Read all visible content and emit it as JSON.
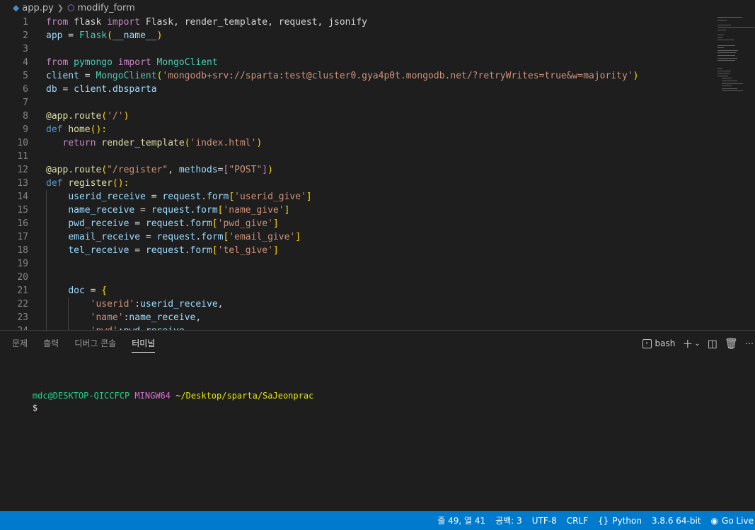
{
  "breadcrumb": {
    "file_icon": "python-file-icon",
    "file": "app.py",
    "separator_icon": "chevron-right-icon",
    "symbol_icon": "symbol-method-icon",
    "symbol": "modify_form"
  },
  "editor": {
    "lines": [
      {
        "n": "1",
        "indent": 0,
        "tokens": [
          {
            "t": "from",
            "c": "ctrl"
          },
          {
            "t": " flask ",
            "c": "op"
          },
          {
            "t": "import",
            "c": "ctrl"
          },
          {
            "t": " Flask, render_template, request, jsonify",
            "c": "op"
          }
        ]
      },
      {
        "n": "2",
        "indent": 0,
        "tokens": [
          {
            "t": "app",
            "c": "var"
          },
          {
            "t": " = ",
            "c": "op"
          },
          {
            "t": "Flask",
            "c": "cls"
          },
          {
            "t": "(",
            "c": "br1"
          },
          {
            "t": "__name__",
            "c": "var"
          },
          {
            "t": ")",
            "c": "br1"
          }
        ]
      },
      {
        "n": "3",
        "indent": 0,
        "tokens": []
      },
      {
        "n": "4",
        "indent": 0,
        "tokens": [
          {
            "t": "from",
            "c": "ctrl"
          },
          {
            "t": " pymongo ",
            "c": "cls"
          },
          {
            "t": "import",
            "c": "ctrl"
          },
          {
            "t": " MongoClient",
            "c": "cls"
          }
        ]
      },
      {
        "n": "5",
        "indent": 0,
        "tokens": [
          {
            "t": "client",
            "c": "var"
          },
          {
            "t": " = ",
            "c": "op"
          },
          {
            "t": "MongoClient",
            "c": "cls"
          },
          {
            "t": "(",
            "c": "br1"
          },
          {
            "t": "'mongodb+srv://sparta:test@cluster0.gya4p0t.mongodb.net/?retryWrites=true&w=majority'",
            "c": "str"
          },
          {
            "t": ")",
            "c": "br1"
          }
        ]
      },
      {
        "n": "6",
        "indent": 0,
        "tokens": [
          {
            "t": "db",
            "c": "var"
          },
          {
            "t": " = ",
            "c": "op"
          },
          {
            "t": "client",
            "c": "var"
          },
          {
            "t": ".",
            "c": "op"
          },
          {
            "t": "dbsparta",
            "c": "var"
          }
        ]
      },
      {
        "n": "7",
        "indent": 0,
        "tokens": []
      },
      {
        "n": "8",
        "indent": 0,
        "tokens": [
          {
            "t": "@app.route",
            "c": "fn"
          },
          {
            "t": "(",
            "c": "br1"
          },
          {
            "t": "'/'",
            "c": "str"
          },
          {
            "t": ")",
            "c": "br1"
          }
        ]
      },
      {
        "n": "9",
        "indent": 0,
        "tokens": [
          {
            "t": "def",
            "c": "kw"
          },
          {
            "t": " ",
            "c": "op"
          },
          {
            "t": "home",
            "c": "fn"
          },
          {
            "t": "():",
            "c": "br1"
          }
        ]
      },
      {
        "n": "10",
        "indent": 0,
        "tokens": [
          {
            "t": "   ",
            "c": "op"
          },
          {
            "t": "return",
            "c": "ctrl"
          },
          {
            "t": " ",
            "c": "op"
          },
          {
            "t": "render_template",
            "c": "fn"
          },
          {
            "t": "(",
            "c": "br1"
          },
          {
            "t": "'index.html'",
            "c": "str"
          },
          {
            "t": ")",
            "c": "br1"
          }
        ]
      },
      {
        "n": "11",
        "indent": 0,
        "tokens": []
      },
      {
        "n": "12",
        "indent": 0,
        "tokens": [
          {
            "t": "@app.route",
            "c": "fn"
          },
          {
            "t": "(",
            "c": "br1"
          },
          {
            "t": "\"/register\"",
            "c": "str"
          },
          {
            "t": ", ",
            "c": "op"
          },
          {
            "t": "methods",
            "c": "var"
          },
          {
            "t": "=",
            "c": "op"
          },
          {
            "t": "[",
            "c": "br2"
          },
          {
            "t": "\"POST\"",
            "c": "str"
          },
          {
            "t": "]",
            "c": "br2"
          },
          {
            "t": ")",
            "c": "br1"
          }
        ]
      },
      {
        "n": "13",
        "indent": 0,
        "tokens": [
          {
            "t": "def",
            "c": "kw"
          },
          {
            "t": " ",
            "c": "op"
          },
          {
            "t": "register",
            "c": "fn"
          },
          {
            "t": "():",
            "c": "br1"
          }
        ]
      },
      {
        "n": "14",
        "indent": 1,
        "tokens": [
          {
            "t": "    ",
            "c": "op"
          },
          {
            "t": "userid_receive",
            "c": "var"
          },
          {
            "t": " = ",
            "c": "op"
          },
          {
            "t": "request",
            "c": "var"
          },
          {
            "t": ".",
            "c": "op"
          },
          {
            "t": "form",
            "c": "var"
          },
          {
            "t": "[",
            "c": "br1"
          },
          {
            "t": "'userid_give'",
            "c": "str"
          },
          {
            "t": "]",
            "c": "br1"
          }
        ]
      },
      {
        "n": "15",
        "indent": 1,
        "tokens": [
          {
            "t": "    ",
            "c": "op"
          },
          {
            "t": "name_receive",
            "c": "var"
          },
          {
            "t": " = ",
            "c": "op"
          },
          {
            "t": "request",
            "c": "var"
          },
          {
            "t": ".",
            "c": "op"
          },
          {
            "t": "form",
            "c": "var"
          },
          {
            "t": "[",
            "c": "br1"
          },
          {
            "t": "'name_give'",
            "c": "str"
          },
          {
            "t": "]",
            "c": "br1"
          }
        ]
      },
      {
        "n": "16",
        "indent": 1,
        "tokens": [
          {
            "t": "    ",
            "c": "op"
          },
          {
            "t": "pwd_receive",
            "c": "var"
          },
          {
            "t": " = ",
            "c": "op"
          },
          {
            "t": "request",
            "c": "var"
          },
          {
            "t": ".",
            "c": "op"
          },
          {
            "t": "form",
            "c": "var"
          },
          {
            "t": "[",
            "c": "br1"
          },
          {
            "t": "'pwd_give'",
            "c": "str"
          },
          {
            "t": "]",
            "c": "br1"
          }
        ]
      },
      {
        "n": "17",
        "indent": 1,
        "tokens": [
          {
            "t": "    ",
            "c": "op"
          },
          {
            "t": "email_receive",
            "c": "var"
          },
          {
            "t": " = ",
            "c": "op"
          },
          {
            "t": "request",
            "c": "var"
          },
          {
            "t": ".",
            "c": "op"
          },
          {
            "t": "form",
            "c": "var"
          },
          {
            "t": "[",
            "c": "br1"
          },
          {
            "t": "'email_give'",
            "c": "str"
          },
          {
            "t": "]",
            "c": "br1"
          }
        ]
      },
      {
        "n": "18",
        "indent": 1,
        "tokens": [
          {
            "t": "    ",
            "c": "op"
          },
          {
            "t": "tel_receive",
            "c": "var"
          },
          {
            "t": " = ",
            "c": "op"
          },
          {
            "t": "request",
            "c": "var"
          },
          {
            "t": ".",
            "c": "op"
          },
          {
            "t": "form",
            "c": "var"
          },
          {
            "t": "[",
            "c": "br1"
          },
          {
            "t": "'tel_give'",
            "c": "str"
          },
          {
            "t": "]",
            "c": "br1"
          }
        ]
      },
      {
        "n": "19",
        "indent": 1,
        "tokens": []
      },
      {
        "n": "20",
        "indent": 1,
        "tokens": []
      },
      {
        "n": "21",
        "indent": 1,
        "tokens": [
          {
            "t": "    ",
            "c": "op"
          },
          {
            "t": "doc",
            "c": "var"
          },
          {
            "t": " = ",
            "c": "op"
          },
          {
            "t": "{",
            "c": "br1"
          }
        ]
      },
      {
        "n": "22",
        "indent": 2,
        "tokens": [
          {
            "t": "        ",
            "c": "op"
          },
          {
            "t": "'userid'",
            "c": "str"
          },
          {
            "t": ":",
            "c": "op"
          },
          {
            "t": "userid_receive",
            "c": "var"
          },
          {
            "t": ",",
            "c": "op"
          }
        ]
      },
      {
        "n": "23",
        "indent": 2,
        "tokens": [
          {
            "t": "        ",
            "c": "op"
          },
          {
            "t": "'name'",
            "c": "str"
          },
          {
            "t": ":",
            "c": "op"
          },
          {
            "t": "name_receive",
            "c": "var"
          },
          {
            "t": ",",
            "c": "op"
          }
        ]
      },
      {
        "n": "24",
        "indent": 2,
        "tokens": [
          {
            "t": "        ",
            "c": "op"
          },
          {
            "t": "'pwd'",
            "c": "str"
          },
          {
            "t": ":",
            "c": "op"
          },
          {
            "t": "pwd_receive",
            "c": "var"
          }
        ]
      }
    ]
  },
  "panel": {
    "tabs": [
      {
        "label": "문제",
        "active": false
      },
      {
        "label": "출력",
        "active": false
      },
      {
        "label": "디버그 콘솔",
        "active": false
      },
      {
        "label": "터미널",
        "active": true
      }
    ],
    "terminal_profile": "bash",
    "terminal_icon": "terminal-icon",
    "add_icon": "plus-icon",
    "dropdown_icon": "chevron-down-icon",
    "split_icon": "split-editor-icon",
    "trash_icon": "trash-icon",
    "more_icon": "ellipsis-icon"
  },
  "terminal": {
    "user_host": "mdc@DESKTOP-QICCFCP",
    "env": "MINGW64",
    "path": "~/Desktop/sparta/SaJeonprac",
    "prompt": "$"
  },
  "statusbar": {
    "position": "줄 49, 열 41",
    "spaces": "공백: 3",
    "encoding": "UTF-8",
    "eol": "CRLF",
    "language": "Python",
    "language_icon": "braces-icon",
    "interpreter": "3.8.6 64-bit",
    "golive": "Go Live",
    "golive_icon": "broadcast-icon"
  },
  "colors": {
    "editor_bg": "#1e1e1e",
    "statusbar_bg": "#007acc",
    "keyword": "#569cd6",
    "control": "#c586c0",
    "string": "#ce9178",
    "variable": "#9cdcfe",
    "function": "#dcdcaa",
    "class": "#4ec9b0"
  }
}
